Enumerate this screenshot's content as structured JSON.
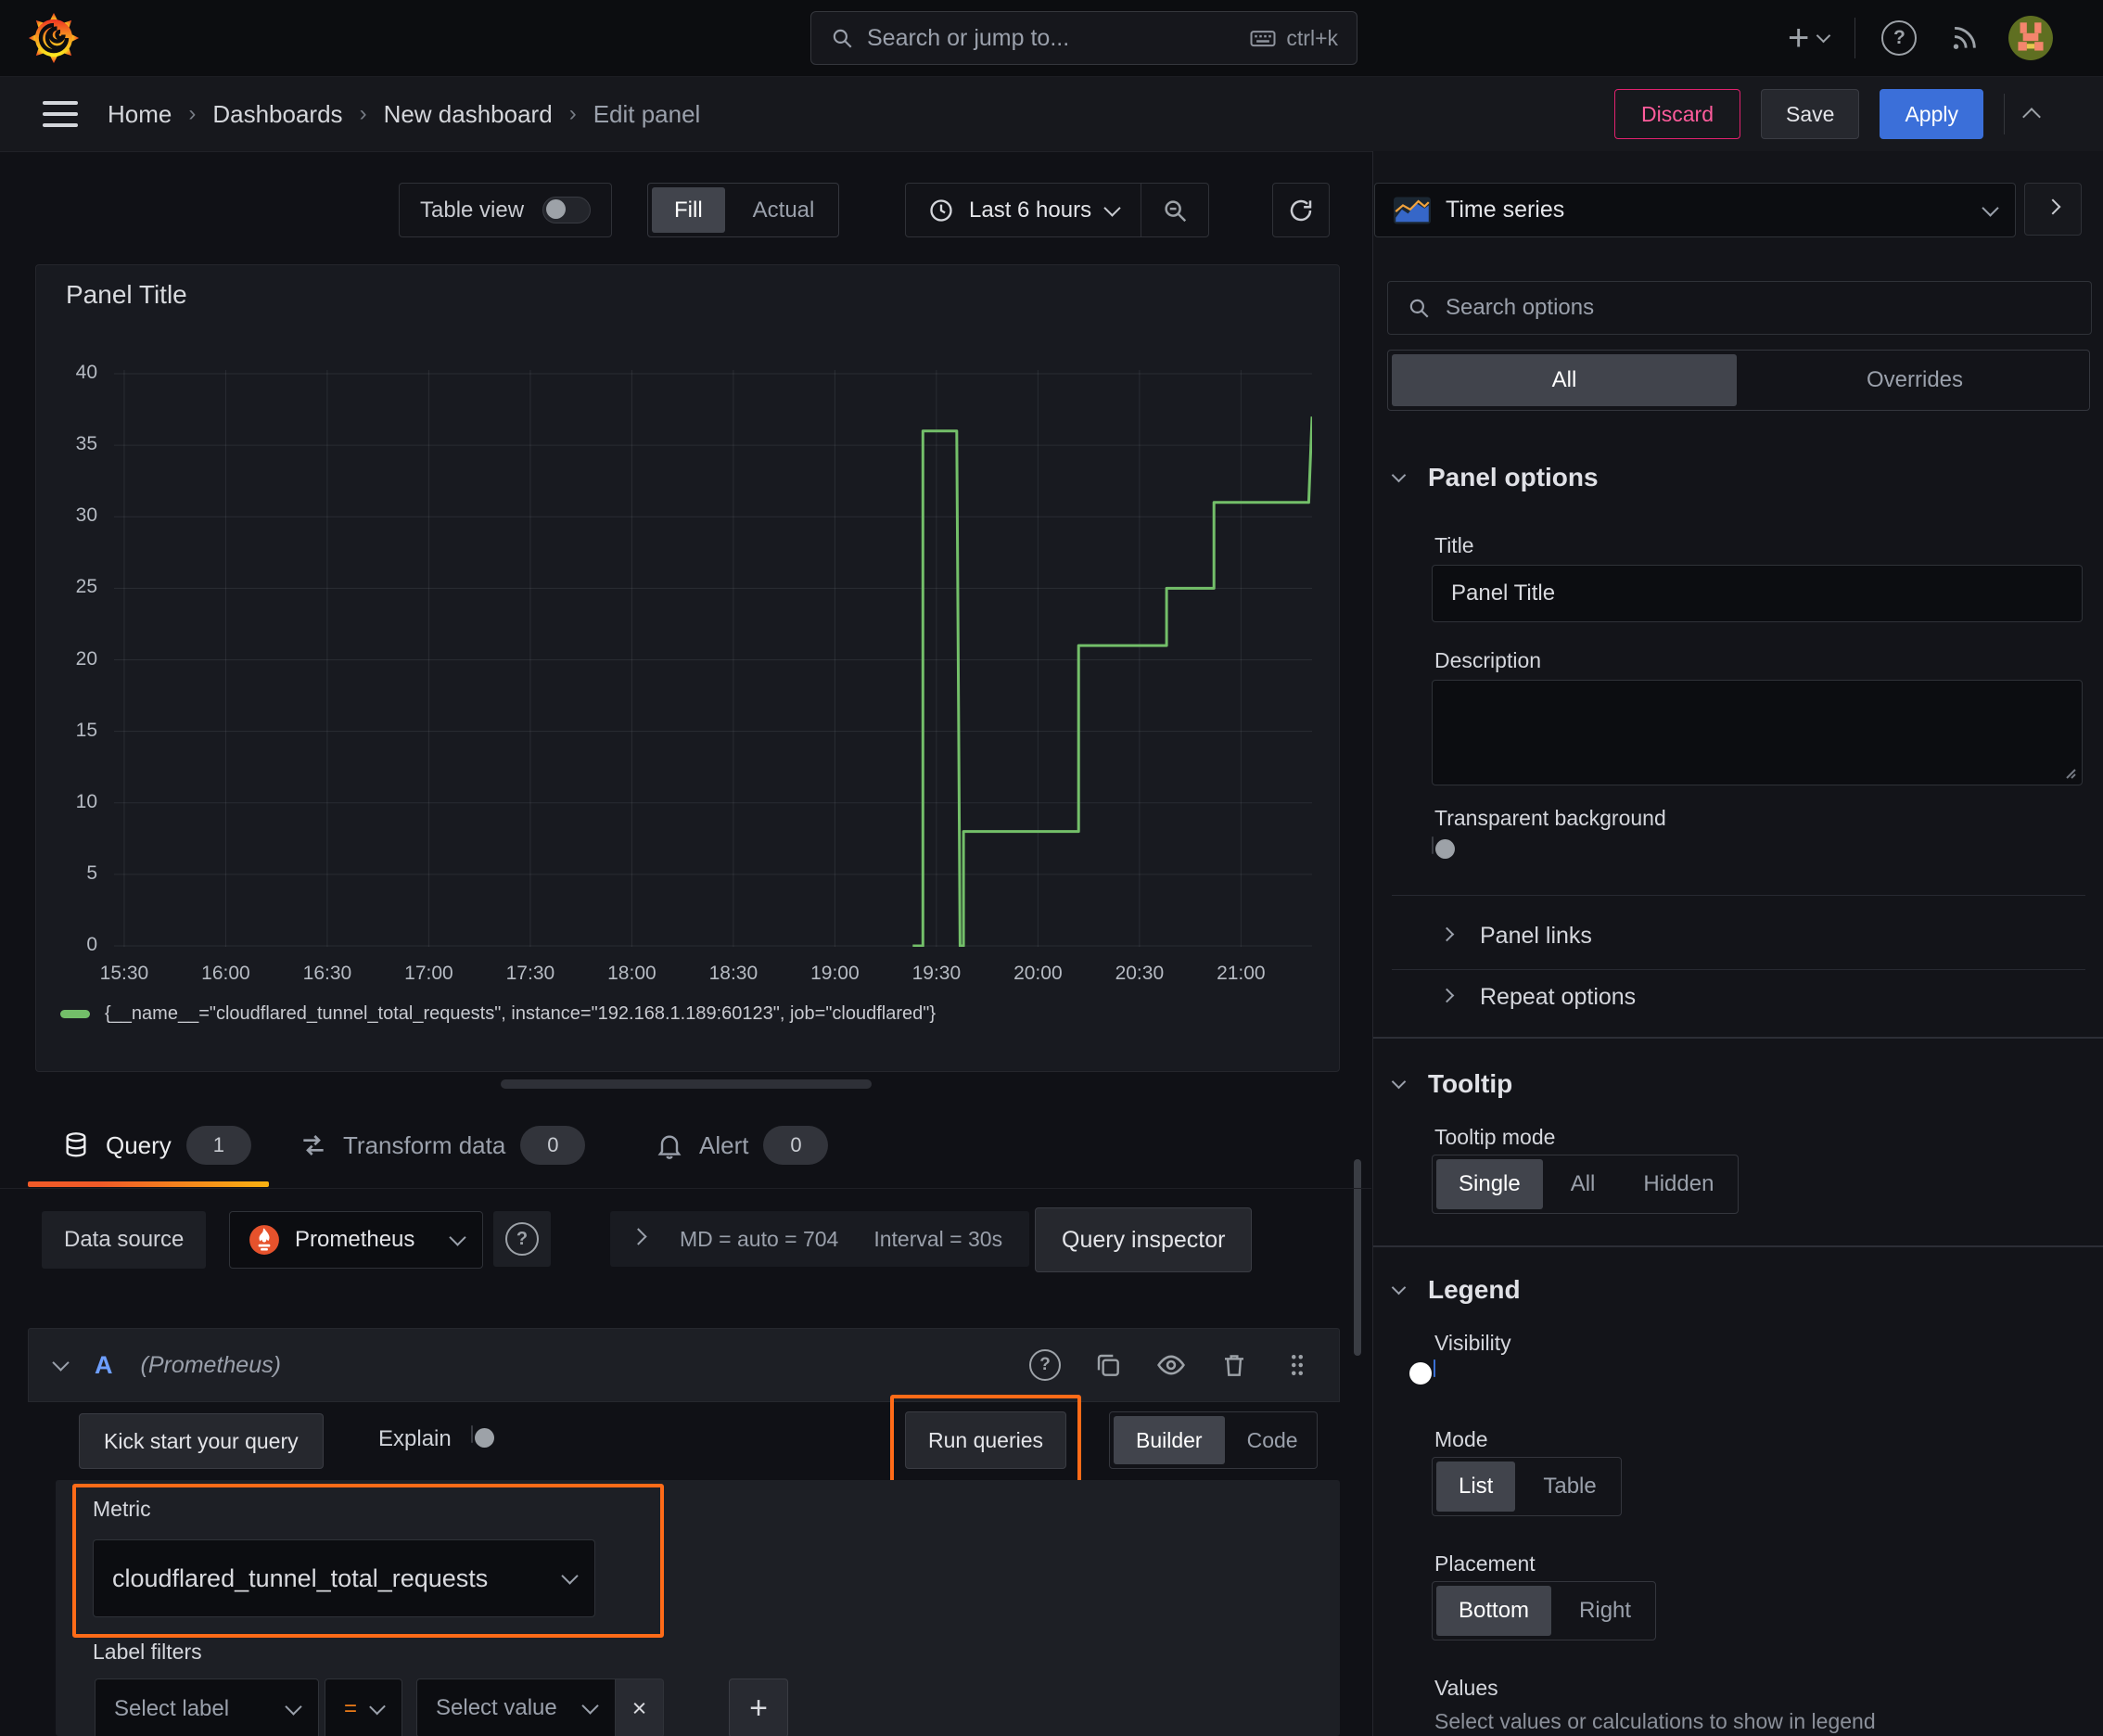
{
  "icons": {
    "plus": "+",
    "question": "?",
    "close": "×"
  },
  "topbar": {
    "search_placeholder": "Search or jump to...",
    "search_shortcut": "ctrl+k"
  },
  "breadcrumb": {
    "items": [
      "Home",
      "Dashboards",
      "New dashboard",
      "Edit panel"
    ],
    "separator": "›"
  },
  "actions": {
    "discard": "Discard",
    "save": "Save",
    "apply": "Apply"
  },
  "toolbar": {
    "table_view_label": "Table view",
    "display_modes": [
      "Fill",
      "Actual"
    ],
    "display_mode_active": "Fill",
    "time_range": "Last 6 hours"
  },
  "panel": {
    "title": "Panel Title",
    "legend_series": "{__name__=\"cloudflared_tunnel_total_requests\", instance=\"192.168.1.189:60123\", job=\"cloudflared\"}"
  },
  "chart_data": {
    "type": "line",
    "line_style": "step",
    "title": "",
    "xlabel": "",
    "ylabel": "",
    "grid": true,
    "legend_position": "bottom",
    "ylim": [
      0,
      40
    ],
    "y_ticks": [
      0,
      5,
      10,
      15,
      20,
      25,
      30,
      35,
      40
    ],
    "x_ticks": [
      "15:30",
      "16:00",
      "16:30",
      "17:00",
      "17:30",
      "18:00",
      "18:30",
      "19:00",
      "19:30",
      "20:00",
      "20:30",
      "21:00"
    ],
    "x_range": [
      "15:27",
      "21:21"
    ],
    "series": [
      {
        "name": "{__name__=\"cloudflared_tunnel_total_requests\", instance=\"192.168.1.189:60123\", job=\"cloudflared\"}",
        "color": "#73BF69",
        "points": [
          [
            "19:23",
            0
          ],
          [
            "19:26",
            0
          ],
          [
            "19:26",
            36
          ],
          [
            "19:36",
            36
          ],
          [
            "19:37",
            0
          ],
          [
            "19:38",
            0
          ],
          [
            "19:38",
            8
          ],
          [
            "20:12",
            8
          ],
          [
            "20:12",
            21
          ],
          [
            "20:38",
            21
          ],
          [
            "20:38",
            25
          ],
          [
            "20:52",
            25
          ],
          [
            "20:52",
            31
          ],
          [
            "21:20",
            31
          ],
          [
            "21:21",
            37
          ]
        ]
      }
    ]
  },
  "query_tabs": [
    {
      "label": "Query",
      "count": "1"
    },
    {
      "label": "Transform data",
      "count": "0"
    },
    {
      "label": "Alert",
      "count": "0"
    }
  ],
  "query": {
    "datasource_label": "Data source",
    "datasource_name": "Prometheus",
    "options_md": "MD = auto = 704",
    "options_interval": "Interval = 30s",
    "inspector_button": "Query inspector",
    "ref_id": "A",
    "ref_hint": "(Prometheus)",
    "kickstart_button": "Kick start your query",
    "explain_label": "Explain",
    "run_button": "Run queries",
    "editor_modes": [
      "Builder",
      "Code"
    ],
    "editor_mode_active": "Builder",
    "metric_label": "Metric",
    "metric_value": "cloudflared_tunnel_total_requests",
    "label_filters_label": "Label filters",
    "select_label_placeholder": "Select label",
    "operator": "=",
    "select_value_placeholder": "Select value"
  },
  "options_pane": {
    "visualization": "Time series",
    "search_placeholder": "Search options",
    "tabs": [
      "All",
      "Overrides"
    ],
    "tab_active": "All",
    "panel_options": {
      "header": "Panel options",
      "title_label": "Title",
      "title_value": "Panel Title",
      "description_label": "Description",
      "description_value": "",
      "transparent_label": "Transparent background"
    },
    "collapsed_sections": [
      "Panel links",
      "Repeat options"
    ],
    "tooltip": {
      "header": "Tooltip",
      "mode_label": "Tooltip mode",
      "modes": [
        "Single",
        "All",
        "Hidden"
      ],
      "mode_active": "Single"
    },
    "legend": {
      "header": "Legend",
      "visibility_label": "Visibility",
      "mode_label": "Mode",
      "modes": [
        "List",
        "Table"
      ],
      "mode_active": "List",
      "placement_label": "Placement",
      "placements": [
        "Bottom",
        "Right"
      ],
      "placement_active": "Bottom",
      "values_label": "Values",
      "values_hint": "Select values or calculations to show in legend"
    }
  }
}
